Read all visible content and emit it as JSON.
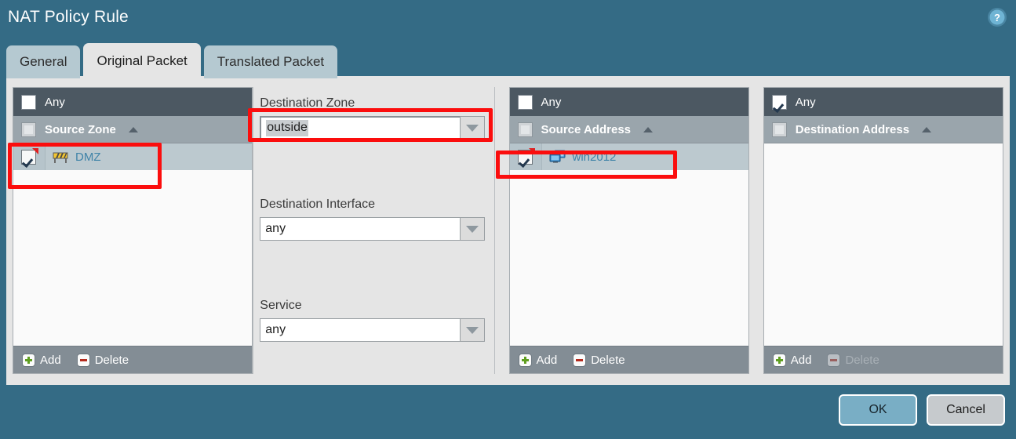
{
  "dialog": {
    "title": "NAT Policy Rule",
    "help_icon": "help-circle-icon",
    "accent_color": "#346b85",
    "annotation_color": "#fb0d0d"
  },
  "tabs": [
    {
      "label": "General",
      "active": false
    },
    {
      "label": "Original Packet",
      "active": true
    },
    {
      "label": "Translated Packet",
      "active": false
    }
  ],
  "source_zone_panel": {
    "any_label": "Any",
    "any_checked": false,
    "column_header": "Source Zone",
    "sort_direction": "ascending",
    "items": [
      {
        "name": "DMZ",
        "checked": true,
        "icon": "zone-barrier-icon",
        "flagged": true
      }
    ],
    "footer": {
      "add_label": "Add",
      "delete_label": "Delete",
      "delete_disabled": false
    }
  },
  "form_column": {
    "destination_zone": {
      "label": "Destination Zone",
      "value": "outside",
      "value_selected": true,
      "focused": true
    },
    "destination_interface": {
      "label": "Destination Interface",
      "value": "any"
    },
    "service": {
      "label": "Service",
      "value": "any"
    }
  },
  "source_address_panel": {
    "any_label": "Any",
    "any_checked": false,
    "column_header": "Source Address",
    "sort_direction": "ascending",
    "items": [
      {
        "name": "win2012",
        "checked": true,
        "icon": "host-computer-icon",
        "flagged": true
      }
    ],
    "footer": {
      "add_label": "Add",
      "delete_label": "Delete",
      "delete_disabled": false
    }
  },
  "destination_address_panel": {
    "any_label": "Any",
    "any_checked": true,
    "column_header": "Destination Address",
    "sort_direction": "ascending",
    "items": [],
    "footer": {
      "add_label": "Add",
      "delete_label": "Delete",
      "delete_disabled": true
    }
  },
  "footer_buttons": {
    "ok_label": "OK",
    "cancel_label": "Cancel"
  }
}
